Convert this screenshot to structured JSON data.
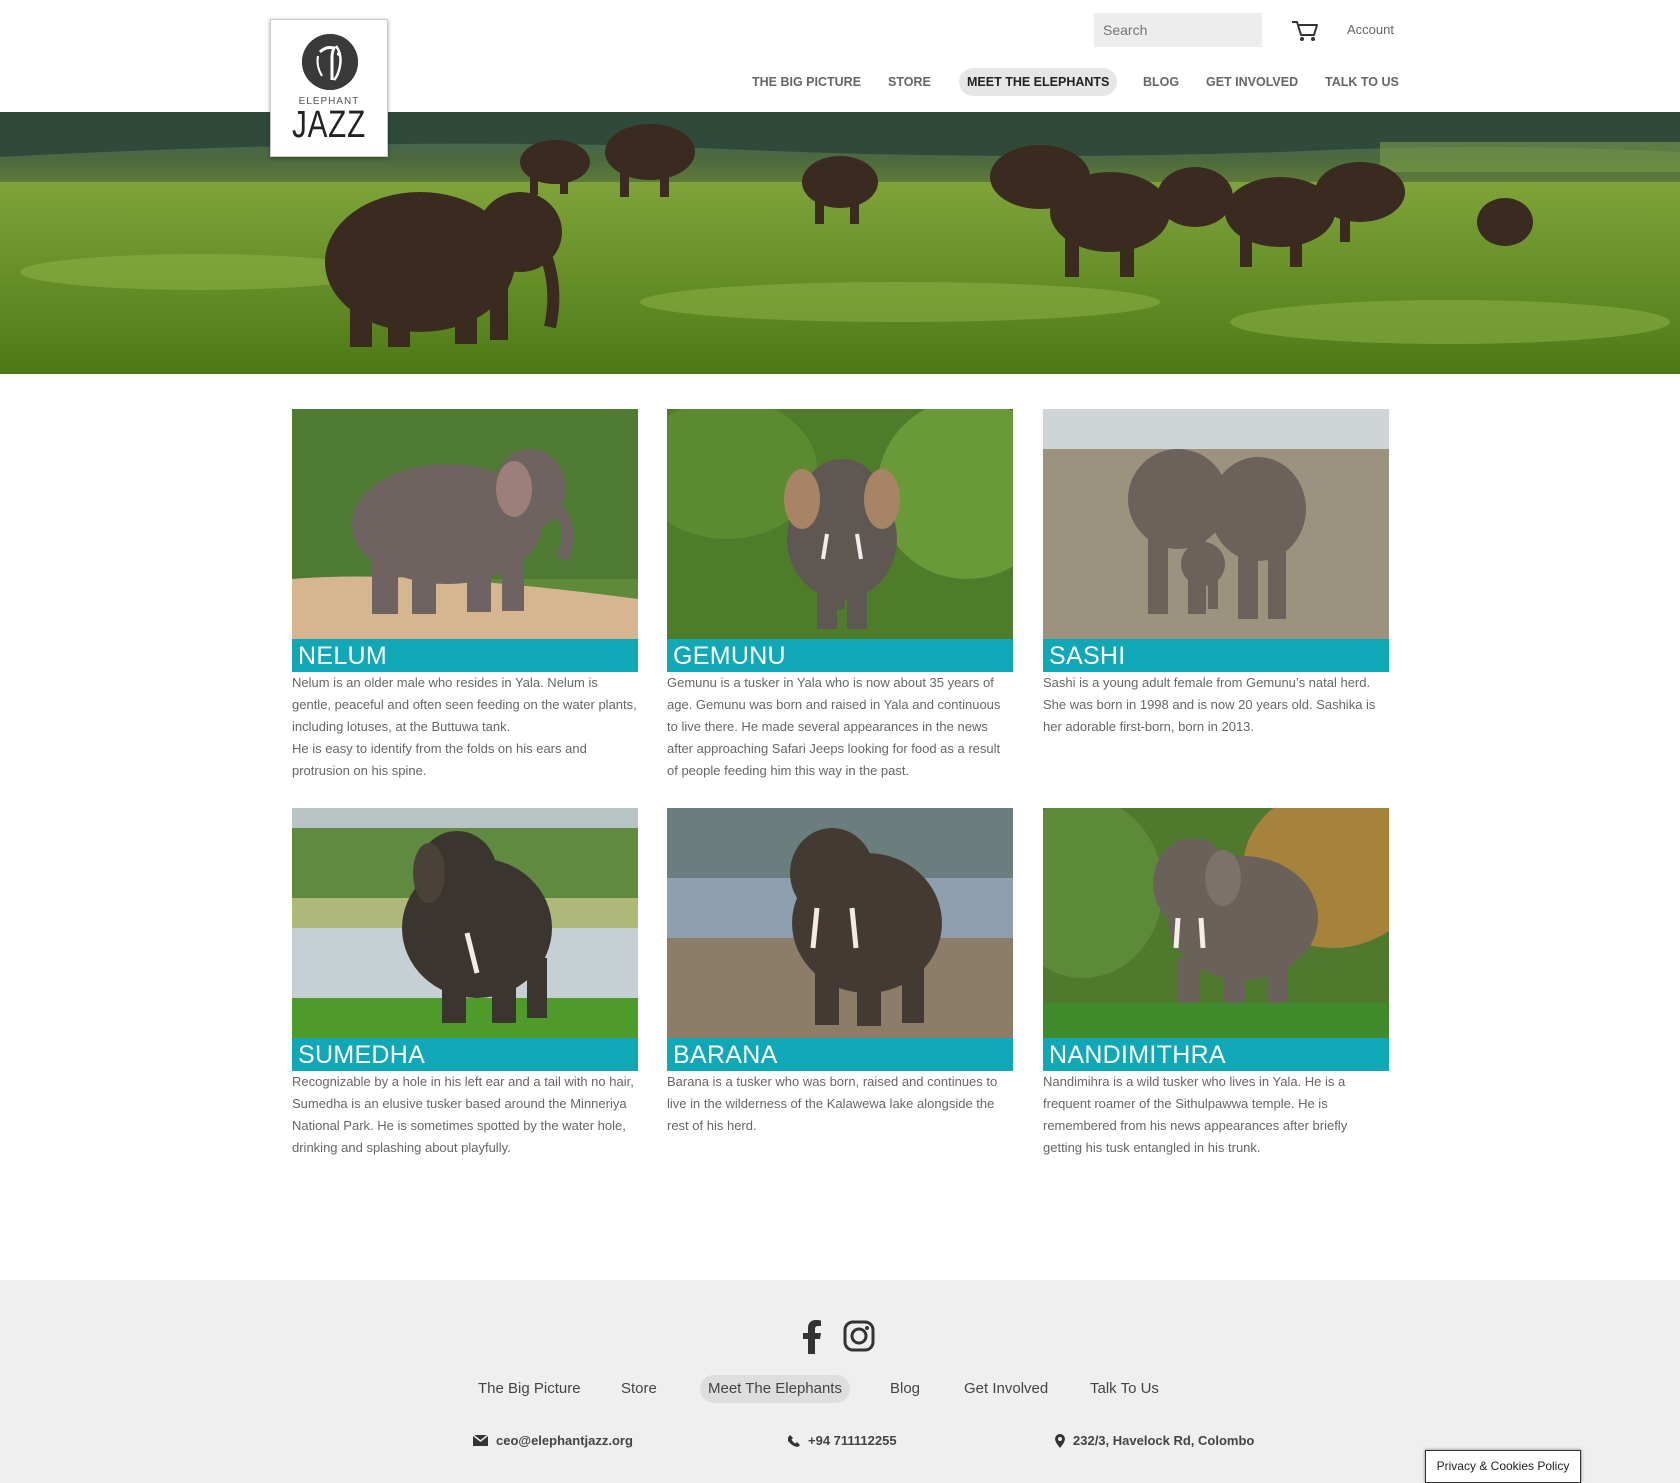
{
  "header": {
    "logo": {
      "small_text": "ELEPHANT",
      "big_text": "JAZZ"
    },
    "search_placeholder": "Search",
    "account_label": "Account",
    "nav": [
      {
        "label": "THE BIG PICTURE"
      },
      {
        "label": "STORE"
      },
      {
        "label": "MEET THE ELEPHANTS",
        "active": true
      },
      {
        "label": "BLOG"
      },
      {
        "label": "GET INVOLVED"
      },
      {
        "label": "TALK TO US"
      }
    ]
  },
  "elephants": [
    {
      "name": "NELUM",
      "description": [
        "Nelum is an older male who resides in Yala. Nelum is gentle, peaceful and often seen feeding on the water plants, including lotuses, at the Buttuwa tank.",
        "He is easy to identify from the folds on his ears and protrusion on his spine."
      ]
    },
    {
      "name": "GEMUNU",
      "description": [
        "Gemunu is a tusker in Yala who is now about 35 years of age. Gemunu was born and raised in Yala and continuous to live there. He made several appearances in the news after approaching Safari Jeeps looking for food as a result of people feeding him this way in the past."
      ]
    },
    {
      "name": "SASHI",
      "description": [
        "Sashi is a young adult female from Gemunu’s natal herd. She was born in 1998 and is now 20 years old. Sashika is her adorable first-born, born in 2013."
      ]
    },
    {
      "name": "SUMEDHA",
      "description": [
        "Recognizable by a hole in his left ear and a tail with no hair, Sumedha is an elusive tusker based around the Minneriya National Park. He is sometimes spotted by the water hole, drinking and splashing about playfully."
      ]
    },
    {
      "name": "BARANA",
      "description": [
        "Barana is a tusker who was born, raised and continues to live in the wilderness of the Kalawewa lake alongside the rest of his herd."
      ]
    },
    {
      "name": "NANDIMITHRA",
      "description": [
        "Nandimihra is a wild tusker who lives in Yala. He is a frequent roamer of the Sithulpawwa temple. He is remembered from his news appearances after briefly getting his tusk entangled in his trunk."
      ]
    }
  ],
  "footer": {
    "nav": [
      {
        "label": "The Big Picture"
      },
      {
        "label": "Store"
      },
      {
        "label": "Meet The Elephants",
        "active": true
      },
      {
        "label": "Blog"
      },
      {
        "label": "Get Involved"
      },
      {
        "label": "Talk To Us"
      }
    ],
    "email": "ceo@elephantjazz.org",
    "phone": "+94 711112255",
    "address": "232/3, Havelock Rd, Colombo",
    "social_icons": [
      "facebook-icon",
      "instagram-icon"
    ]
  },
  "privacy_label": "Privacy & Cookies Policy",
  "colors": {
    "accent": "#10a7b7",
    "footer_bg": "#efefef"
  }
}
